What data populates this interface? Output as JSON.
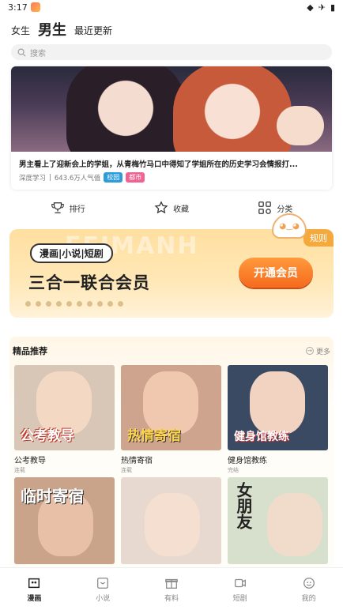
{
  "status": {
    "time": "3:17"
  },
  "top_tabs": [
    "女生",
    "男生",
    "最近更新"
  ],
  "search": {
    "placeholder": "搜索"
  },
  "banner": {
    "title": "男主看上了迎新会上的学姐，从青梅竹马口中得知了学姐所在的历史学习会情报打...",
    "author": "深度学习",
    "popularity": "643.6万人气值",
    "tags": [
      {
        "label": "校园",
        "color": "#2d9cdb"
      },
      {
        "label": "都市",
        "color": "#f06292"
      }
    ]
  },
  "nav": [
    "排行",
    "收藏",
    "分类"
  ],
  "vip": {
    "bg_text": "FEIMANH",
    "rules": "规则",
    "subtitle": "漫画|小说|短剧",
    "headline": "三合一联合会员",
    "button": "开通会员"
  },
  "section": {
    "title": "精品推荐",
    "more": "更多"
  },
  "books": [
    {
      "name": "公考教导",
      "sub": "连载",
      "art": "公考教导",
      "bg": "#d8c6b6",
      "face": "#f3d9c4"
    },
    {
      "name": "热情寄宿",
      "sub": "连载",
      "art": "热情寄宿",
      "bg": "#cfa48e",
      "face": "#f0c8b0"
    },
    {
      "name": "健身馆教练",
      "sub": "完结",
      "art": "健身馆教练",
      "bg": "#3a4a62",
      "face": "#f2d2c0"
    }
  ],
  "books_row2": [
    {
      "art": "临时寄宿",
      "bg": "#c9a48a",
      "face": "#e8c0a8"
    },
    {
      "art": "",
      "bg": "#e7d9cf",
      "face": "#f4dfd0"
    },
    {
      "art": "女朋友",
      "bg": "#d7e0cc",
      "face": "#f1dccc"
    }
  ],
  "bottom_nav": [
    "漫画",
    "小说",
    "有料",
    "短剧",
    "我的"
  ]
}
